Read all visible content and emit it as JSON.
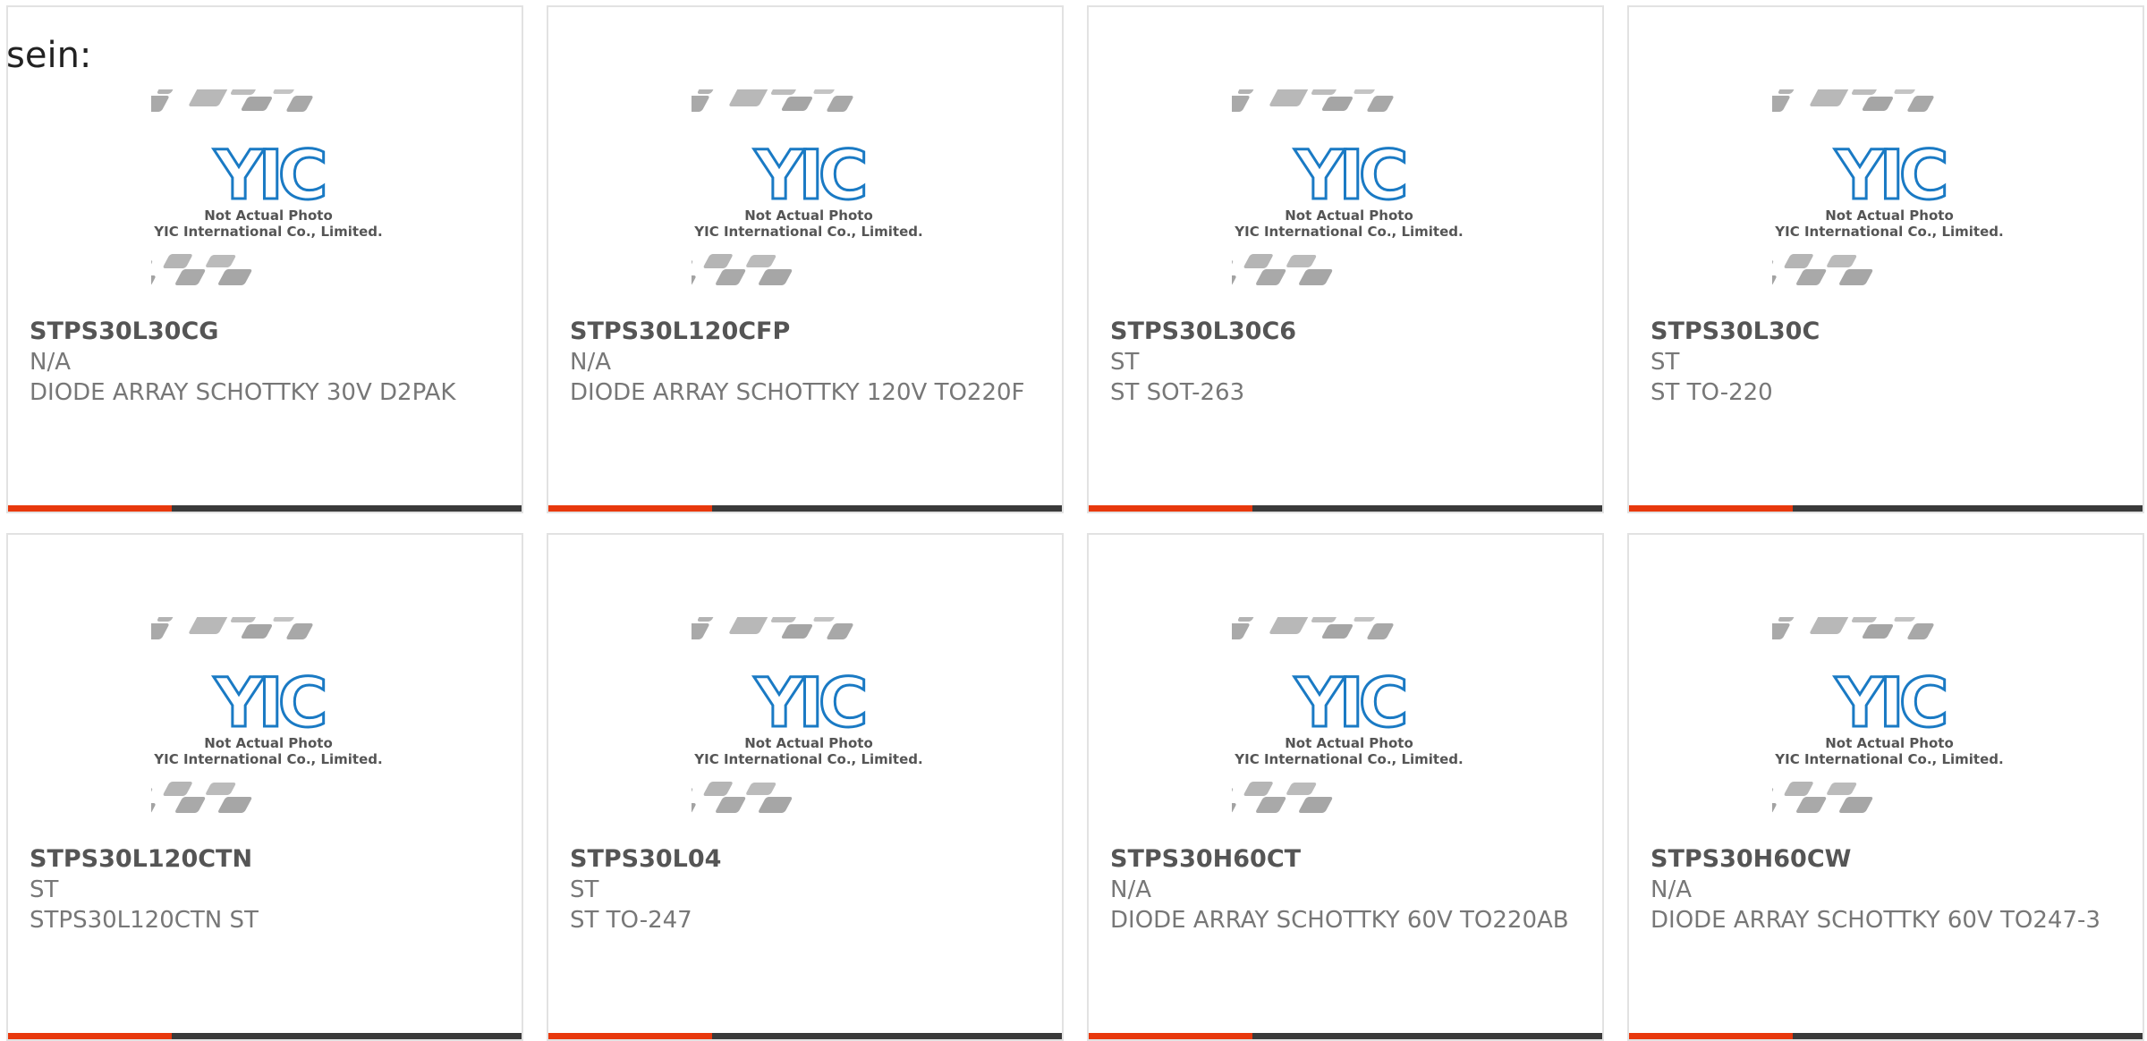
{
  "lead_text": "sein:",
  "placeholder_image": {
    "line1": "Not Actual Photo",
    "line2": "YIC International Co., Limited.",
    "brand": "YIC"
  },
  "colors": {
    "accent": "#e8380d",
    "bar": "#3a3a3a",
    "logo": "#1a7ac4"
  },
  "products": [
    {
      "part": "STPS30L30CG",
      "manufacturer": "N/A",
      "description": "DIODE ARRAY SCHOTTKY 30V D2PAK"
    },
    {
      "part": "STPS30L120CFP",
      "manufacturer": "N/A",
      "description": "DIODE ARRAY SCHOTTKY 120V TO220F"
    },
    {
      "part": "STPS30L30C6",
      "manufacturer": "ST",
      "description": "ST SOT-263"
    },
    {
      "part": "STPS30L30C",
      "manufacturer": "ST",
      "description": "ST TO-220"
    },
    {
      "part": "STPS30L120CTN",
      "manufacturer": "ST",
      "description": "STPS30L120CTN ST"
    },
    {
      "part": "STPS30L04",
      "manufacturer": "ST",
      "description": "ST TO-247"
    },
    {
      "part": "STPS30H60CT",
      "manufacturer": "N/A",
      "description": "DIODE ARRAY SCHOTTKY 60V TO220AB"
    },
    {
      "part": "STPS30H60CW",
      "manufacturer": "N/A",
      "description": "DIODE ARRAY SCHOTTKY 60V TO247-3"
    }
  ]
}
